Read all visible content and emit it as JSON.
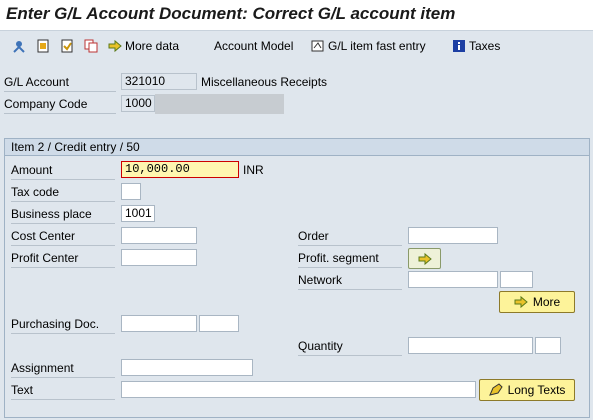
{
  "window": {
    "title": "Enter G/L Account Document: Correct G/L account item"
  },
  "toolbar": {
    "more_data": "More data",
    "account_model": "Account Model",
    "gl_fast_entry": "G/L item fast entry",
    "taxes": "Taxes"
  },
  "header": {
    "gl_account_label": "G/L Account",
    "gl_account_value": "321010",
    "gl_account_desc": "Miscellaneous Receipts",
    "company_code_label": "Company Code",
    "company_code_value": "1000"
  },
  "item": {
    "title": "Item 2 / Credit entry / 50",
    "amount_label": "Amount",
    "amount_value": "10,000.00",
    "currency": "INR",
    "tax_code_label": "Tax code",
    "business_place_label": "Business place",
    "business_place_value": "1001",
    "cost_center_label": "Cost Center",
    "profit_center_label": "Profit Center",
    "order_label": "Order",
    "profit_segment_label": "Profit. segment",
    "network_label": "Network",
    "more_button": "More",
    "purchasing_doc_label": "Purchasing Doc.",
    "quantity_label": "Quantity",
    "assignment_label": "Assignment",
    "text_label": "Text",
    "long_texts_button": "Long Texts"
  },
  "colors": {
    "button_yellow": "#fdf39a",
    "frame_blue": "#9fb2c5",
    "required_red": "#cc0000"
  }
}
